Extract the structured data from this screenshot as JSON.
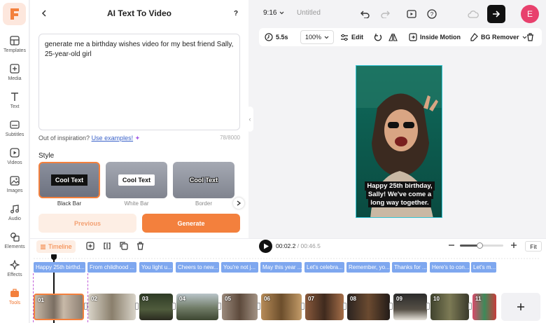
{
  "app": {
    "logo_letter": "F",
    "accent": "#f3803d"
  },
  "sidebar": {
    "items": [
      {
        "label": "Templates",
        "icon": "templates-icon"
      },
      {
        "label": "Media",
        "icon": "media-icon"
      },
      {
        "label": "Text",
        "icon": "text-icon"
      },
      {
        "label": "Subtitles",
        "icon": "subtitles-icon"
      },
      {
        "label": "Videos",
        "icon": "videos-icon"
      },
      {
        "label": "Images",
        "icon": "images-icon"
      },
      {
        "label": "Audio",
        "icon": "audio-icon"
      },
      {
        "label": "Elements",
        "icon": "elements-icon"
      },
      {
        "label": "Effects",
        "icon": "effects-icon"
      },
      {
        "label": "Tools",
        "icon": "tools-icon"
      }
    ]
  },
  "panel": {
    "title": "AI Text To Video",
    "help": "?",
    "prompt": "generate me a birthday wishes video for my best friend Sally, 25-year-old girl",
    "inspire_text": "Out of inspiration?",
    "inspire_link": "Use examples!",
    "counter": "78/8000",
    "style_label": "Style",
    "styles": [
      {
        "preview": "Cool Text",
        "name": "Black Bar",
        "selected": true
      },
      {
        "preview": "Cool Text",
        "name": "White Bar",
        "selected": false
      },
      {
        "preview": "Cool Text",
        "name": "Border",
        "selected": false
      }
    ],
    "previous": "Previous",
    "generate": "Generate"
  },
  "topbar": {
    "ratio": "9:16",
    "project_title": "Untitled",
    "avatar": "E"
  },
  "edit_bar": {
    "duration": "5.5s",
    "zoom": "100%",
    "edit": "Edit",
    "inside_motion": "Inside Motion",
    "bg_remover": "BG Remover"
  },
  "preview": {
    "caption": "Happy 25th birthday, Sally! We've come a long way together."
  },
  "timeline": {
    "label": "Timeline",
    "current_time": "00:02.2",
    "total_time": "/ 00:46.5",
    "fit": "Fit",
    "zoom_level": 0.45,
    "captions": [
      "Happy 25th birthd...",
      "From childhood ...",
      "You light u...",
      "Cheers to new...",
      "You're not j...",
      "May this year ...",
      "Let's celebra...",
      "Remember, yo...",
      "Thanks for ...",
      "Here's to con...",
      "Let's m..."
    ],
    "clips": [
      "01",
      "02",
      "03",
      "04",
      "05",
      "06",
      "07",
      "08",
      "09",
      "10",
      "11"
    ]
  }
}
